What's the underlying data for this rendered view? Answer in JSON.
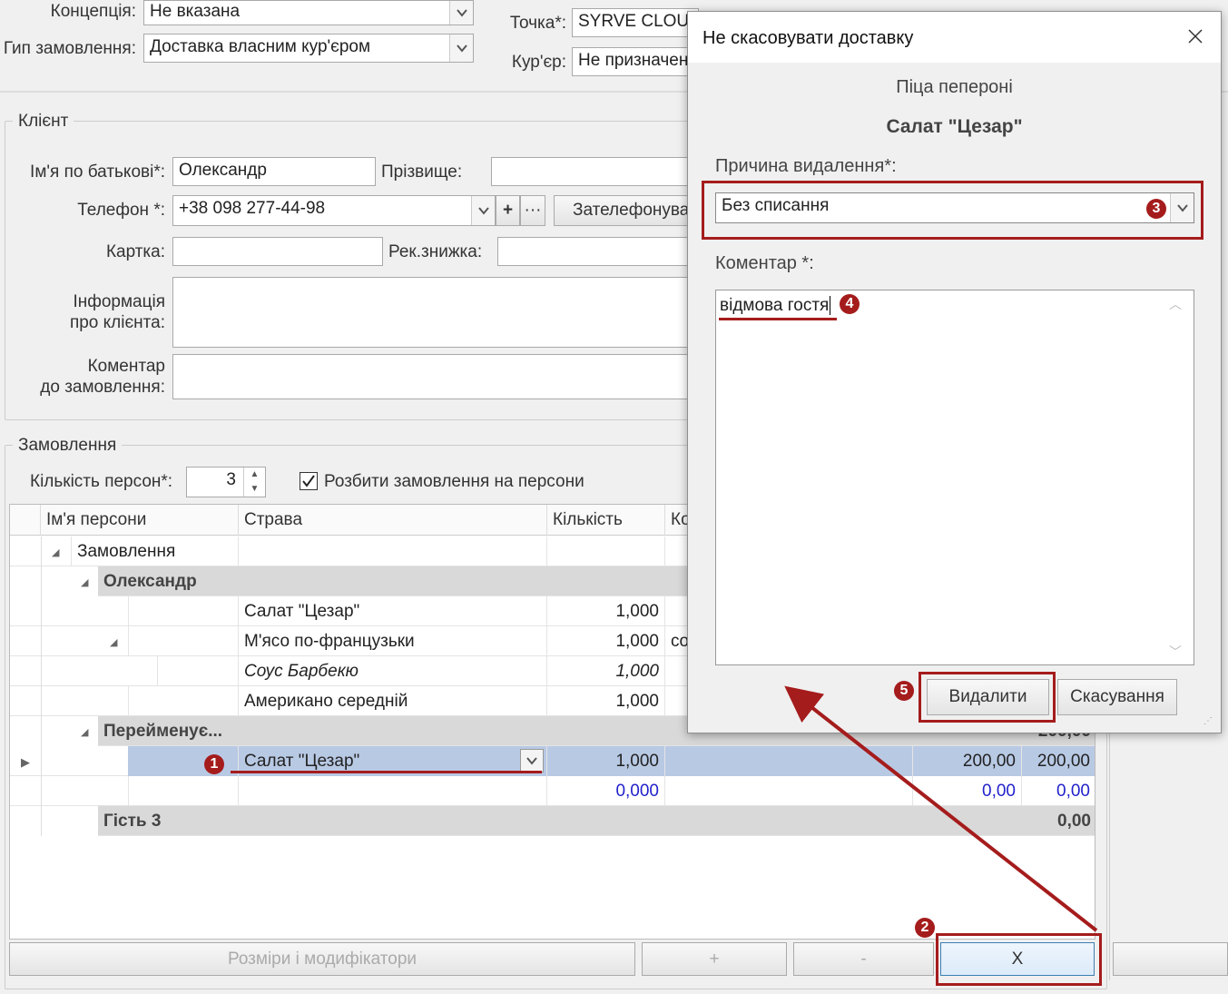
{
  "header": {
    "concept_label": "Концепція:",
    "concept_value": "Не вказана",
    "order_type_label": "Гип замовлення:",
    "order_type_value": "Доставка власним кур'єром",
    "point_label": "Точка*:",
    "point_value": "SYRVE CLOUD",
    "courier_label": "Кур'єр:",
    "courier_value": "Не призначен"
  },
  "client": {
    "group_title": "Клієнт",
    "patronymic_label": "Ім'я по батькові*:",
    "patronymic_value": "Олександр",
    "surname_label": "Прізвище:",
    "surname_value": "",
    "phone_label": "Телефон *:",
    "phone_value": "+38 098 277-44-98",
    "call_button": "Зателефонува",
    "card_label": "Картка:",
    "card_value": "",
    "discount_label": "Рек.знижка:",
    "discount_value": "",
    "info_label_1": "Інформація",
    "info_label_2": "про клієнта:",
    "comment_label_1": "Коментар",
    "comment_label_2": "до замовлення:"
  },
  "order": {
    "group_title": "Замовлення",
    "persons_label": "Кількість персон*:",
    "persons_value": "3",
    "split_label": "Розбити замовлення на персони",
    "split_checked": true,
    "columns": [
      "Ім'я персони",
      "Страва",
      "Кількість",
      "Ко"
    ],
    "rows": [
      {
        "name": "Замовлення",
        "dish": "",
        "qty": "",
        "c4": "",
        "p1": "",
        "p2": ""
      },
      {
        "name": "Олександр",
        "dish": "",
        "qty": "",
        "c4": "",
        "p1": "",
        "p2": ""
      },
      {
        "name": "",
        "dish": "Салат \"Цезар\"",
        "qty": "1,000",
        "c4": "",
        "p1": "",
        "p2": ""
      },
      {
        "name": "",
        "dish": "М'ясо по-французьки",
        "qty": "1,000",
        "c4": "co",
        "p1": "",
        "p2": ""
      },
      {
        "name": "",
        "dish": "Соус Барбекю",
        "qty": "1,000",
        "c4": "",
        "p1": "",
        "p2": ""
      },
      {
        "name": "",
        "dish": "Американо середній",
        "qty": "1,000",
        "c4": "",
        "p1": "",
        "p2": ""
      },
      {
        "name": "Перейменує...",
        "dish": "",
        "qty": "",
        "c4": "",
        "p1": "",
        "p2": "200,00"
      },
      {
        "name": "",
        "dish": "Салат \"Цезар\"",
        "qty": "1,000",
        "c4": "",
        "p1": "200,00",
        "p2": "200,00"
      },
      {
        "name": "",
        "dish": "",
        "qty": "0,000",
        "c4": "",
        "p1": "0,00",
        "p2": "0,00"
      },
      {
        "name": "Гість 3",
        "dish": "",
        "qty": "",
        "c4": "",
        "p1": "",
        "p2": "0,00"
      }
    ],
    "btn_modifiers": "Розміри і модифікатори",
    "btn_plus": "+",
    "btn_minus": "-",
    "btn_delete": "X"
  },
  "dialog": {
    "title": "Не скасовувати доставку",
    "item_1": "Піца пепероні",
    "item_2": "Салат \"Цезар\"",
    "reason_label": "Причина видалення*:",
    "reason_value": "Без списання",
    "comment_label": "Коментар *:",
    "comment_value": "відмова гостя",
    "delete_button": "Видалити",
    "cancel_button": "Скасування"
  },
  "annotations": {
    "badge_1": "1",
    "badge_2": "2",
    "badge_3": "3",
    "badge_4": "4",
    "badge_5": "5",
    "accent_color": "#a51c1c"
  }
}
